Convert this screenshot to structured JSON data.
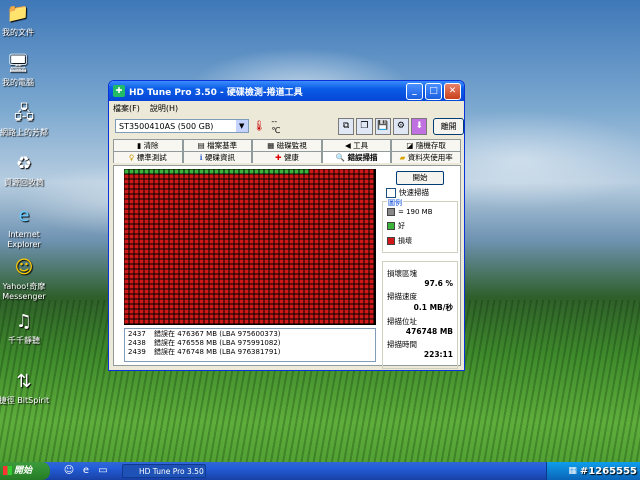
{
  "desktop": {
    "icons": [
      {
        "label": "我的文件",
        "icon": "folder-documents-icon"
      },
      {
        "label": "我的電腦",
        "icon": "computer-icon"
      },
      {
        "label": "網路上的芳鄰",
        "icon": "network-icon"
      },
      {
        "label": "資源回收筒",
        "icon": "recycle-bin-icon"
      },
      {
        "label": "Internet Explorer",
        "icon": "internet-explorer-icon"
      },
      {
        "label": "Yahoo!奇摩 Messenger",
        "icon": "yahoo-messenger-icon"
      },
      {
        "label": "千千靜聽",
        "icon": "music-player-icon"
      },
      {
        "label": "捷徑 BitSpirit",
        "icon": "bitspirit-icon"
      }
    ]
  },
  "window": {
    "title": "HD Tune Pro 3.50 - 硬碟檢測-捲道工具",
    "menu": [
      "檔案(F)",
      "說明(H)"
    ],
    "drive": "ST3500410AS (500 GB)",
    "temperature": "-- ℃",
    "exit_label": "離開",
    "tabs_row1": [
      "清除",
      "檔案基準",
      "磁碟監視",
      "工具",
      "隨機存取"
    ],
    "tabs_row2": [
      "標準測試",
      "硬碟資訊",
      "健康",
      "錯誤掃描",
      "資料夾使用率"
    ],
    "active_tab": "錯誤掃描",
    "start_button": "開始",
    "quick_scan": "快速掃描",
    "legend": {
      "title": "圖例",
      "block_size": "= 190 MB",
      "good": "好",
      "bad": "損壞"
    },
    "stats": {
      "damaged_label": "損壞區塊",
      "damaged_value": "97.6 %",
      "speed_label": "掃描速度",
      "speed_value": "0.1 MB/秒",
      "position_label": "掃描位址",
      "position_value": "476748 MB",
      "elapsed_label": "掃描時間",
      "elapsed_value": "223:11"
    },
    "log": [
      {
        "n": "2437",
        "text": "錯誤在 476367 MB (LBA 975600373)"
      },
      {
        "n": "2438",
        "text": "錯誤在 476558 MB (LBA 975991082)"
      },
      {
        "n": "2439",
        "text": "錯誤在 476748 MB (LBA 976381791)"
      }
    ],
    "scan_map": {
      "good_color": "#3cb43c",
      "bad_color": "#d01818",
      "good_fraction": 0.024
    }
  },
  "taskbar": {
    "start_label": "開始",
    "task_item": "HD Tune Pro 3.50 - ...",
    "watermark": "#1265555"
  }
}
